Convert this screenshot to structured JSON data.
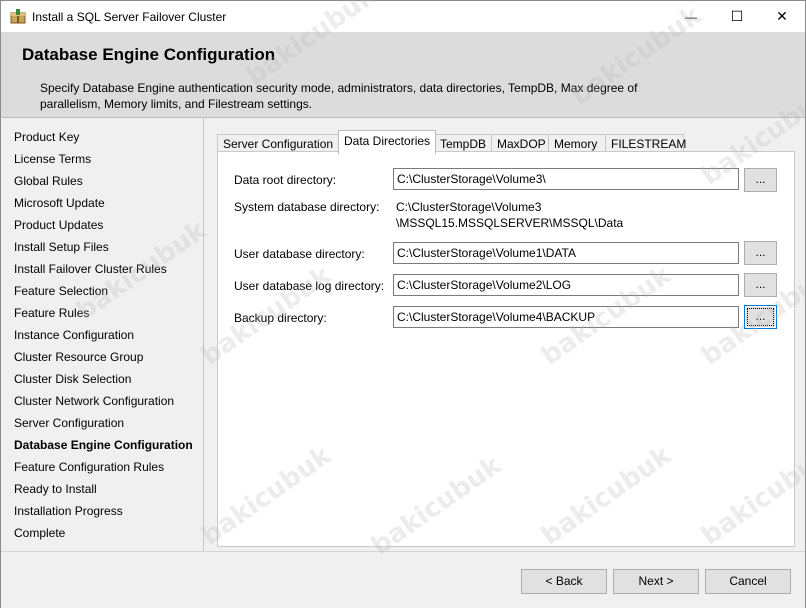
{
  "window": {
    "title": "Install a SQL Server Failover Cluster",
    "minimize_glyph": "—",
    "maximize_glyph": "☐",
    "close_glyph": "✕"
  },
  "header": {
    "title": "Database Engine Configuration",
    "description": "Specify Database Engine authentication security mode, administrators, data directories, TempDB, Max degree of parallelism, Memory limits, and Filestream settings."
  },
  "nav": {
    "items": [
      {
        "label": "Product Key",
        "active": false
      },
      {
        "label": "License Terms",
        "active": false
      },
      {
        "label": "Global Rules",
        "active": false
      },
      {
        "label": "Microsoft Update",
        "active": false
      },
      {
        "label": "Product Updates",
        "active": false
      },
      {
        "label": "Install Setup Files",
        "active": false
      },
      {
        "label": "Install Failover Cluster Rules",
        "active": false
      },
      {
        "label": "Feature Selection",
        "active": false
      },
      {
        "label": "Feature Rules",
        "active": false
      },
      {
        "label": "Instance Configuration",
        "active": false
      },
      {
        "label": "Cluster Resource Group",
        "active": false
      },
      {
        "label": "Cluster Disk Selection",
        "active": false
      },
      {
        "label": "Cluster Network Configuration",
        "active": false
      },
      {
        "label": "Server Configuration",
        "active": false
      },
      {
        "label": "Database Engine Configuration",
        "active": true
      },
      {
        "label": "Feature Configuration Rules",
        "active": false
      },
      {
        "label": "Ready to Install",
        "active": false
      },
      {
        "label": "Installation Progress",
        "active": false
      },
      {
        "label": "Complete",
        "active": false
      }
    ]
  },
  "tabs": [
    {
      "label": "Server Configuration",
      "active": false
    },
    {
      "label": "Data Directories",
      "active": true
    },
    {
      "label": "TempDB",
      "active": false
    },
    {
      "label": "MaxDOP",
      "active": false
    },
    {
      "label": "Memory",
      "active": false
    },
    {
      "label": "FILESTREAM",
      "active": false
    }
  ],
  "directories": {
    "data_root_label": "Data root directory:",
    "data_root_value": "C:\\ClusterStorage\\Volume3\\",
    "system_db_label": "System database directory:",
    "system_db_value_line1": "C:\\ClusterStorage\\Volume3",
    "system_db_value_line2": "\\MSSQL15.MSSQLSERVER\\MSSQL\\Data",
    "user_db_label": "User database directory:",
    "user_db_value": "C:\\ClusterStorage\\Volume1\\DATA",
    "user_log_label": "User database log directory:",
    "user_log_value": "C:\\ClusterStorage\\Volume2\\LOG",
    "backup_label": "Backup directory:",
    "backup_value": "C:\\ClusterStorage\\Volume4\\BACKUP",
    "browse_label": "..."
  },
  "footer": {
    "back_label": "< Back",
    "next_label": "Next >",
    "cancel_label": "Cancel"
  },
  "watermark": "bakicubuk"
}
